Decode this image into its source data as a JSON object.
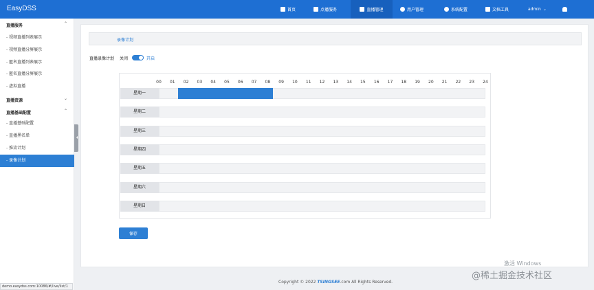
{
  "app": {
    "title": "EasyDSS"
  },
  "topnav": {
    "home": "首页",
    "vod": "点播服务",
    "live": "直播管理",
    "user": "用户管理",
    "sys": "系统配置",
    "doc": "文档工具",
    "admin": "admin"
  },
  "sidebar": {
    "group1": "直播服务",
    "group1_items": [
      "- 视频直播列表展示",
      "- 视频直播分屏展示",
      "- 匿名直播列表展示",
      "- 匿名直播分屏展示",
      "- 虚拟直播"
    ],
    "group2": "直播资源",
    "group3": "直播基础配置",
    "group3_items": [
      "- 直播基础配置",
      "- 直播黑名单",
      "- 推流计划",
      "- 录像计划"
    ],
    "active_item": "- 录像计划"
  },
  "page": {
    "tab": "录像计划",
    "switch_label": "直播录像计划",
    "switch_off": "关闭",
    "switch_on": "开启",
    "switch_state": true,
    "save": "保存"
  },
  "schedule": {
    "hours": [
      "00",
      "01",
      "02",
      "03",
      "04",
      "05",
      "06",
      "07",
      "08",
      "09",
      "10",
      "11",
      "12",
      "13",
      "14",
      "15",
      "16",
      "17",
      "18",
      "19",
      "20",
      "21",
      "22",
      "23",
      "24"
    ],
    "days": [
      {
        "label": "星期一",
        "ranges": [
          [
            1.35,
            8.35
          ]
        ]
      },
      {
        "label": "星期二",
        "ranges": []
      },
      {
        "label": "星期三",
        "ranges": []
      },
      {
        "label": "星期四",
        "ranges": []
      },
      {
        "label": "星期五",
        "ranges": []
      },
      {
        "label": "星期六",
        "ranges": []
      },
      {
        "label": "星期日",
        "ranges": []
      }
    ]
  },
  "footer": {
    "pre": "Copyright © 2022 ",
    "logo": "TSINGSEE",
    "post": ".com All Rights Reserved."
  },
  "statusbar": "demo.easydss.com:10086/#/live/list/1",
  "watermark": {
    "line1": "激活 Windows",
    "line2": "@稀土掘金技术社区"
  },
  "colors": {
    "primary": "#2d7fd4",
    "topbar": "#1e6fd3"
  }
}
